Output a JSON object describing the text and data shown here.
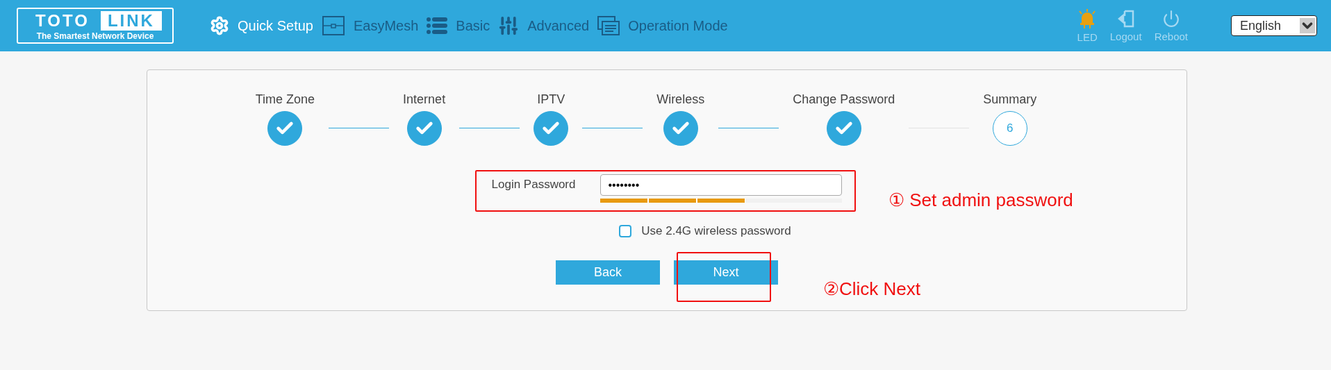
{
  "header": {
    "logo": {
      "left": "TOTO",
      "right": "LINK",
      "tagline": "The Smartest Network Device"
    },
    "nav": [
      {
        "label": "Quick Setup",
        "kind": "gear",
        "selected": true
      },
      {
        "label": "EasyMesh",
        "kind": "mesh",
        "selected": false
      },
      {
        "label": "Basic",
        "kind": "list",
        "selected": false
      },
      {
        "label": "Advanced",
        "kind": "sliders",
        "selected": false
      },
      {
        "label": "Operation Mode",
        "kind": "windows",
        "selected": false
      }
    ],
    "actions": [
      {
        "label": "LED",
        "kind": "led",
        "on": true
      },
      {
        "label": "Logout",
        "kind": "logout",
        "on": false
      },
      {
        "label": "Reboot",
        "kind": "power",
        "on": false
      }
    ],
    "language": "English"
  },
  "steps": [
    {
      "label": "Time Zone",
      "done": true
    },
    {
      "label": "Internet",
      "done": true
    },
    {
      "label": "IPTV",
      "done": true
    },
    {
      "label": "Wireless",
      "done": true
    },
    {
      "label": "Change Password",
      "done": true
    },
    {
      "label": "Summary",
      "done": false,
      "number": "6"
    }
  ],
  "form": {
    "label": "Login Password",
    "value": "••••••••",
    "strength": {
      "level": 0.6
    },
    "checkbox": {
      "label": "Use 2.4G wireless password",
      "checked": false
    }
  },
  "buttons": [
    {
      "label": "Back"
    },
    {
      "label": "Next"
    }
  ],
  "annotations": [
    {
      "text": "① Set admin password"
    },
    {
      "text": "②Click Next"
    }
  ]
}
